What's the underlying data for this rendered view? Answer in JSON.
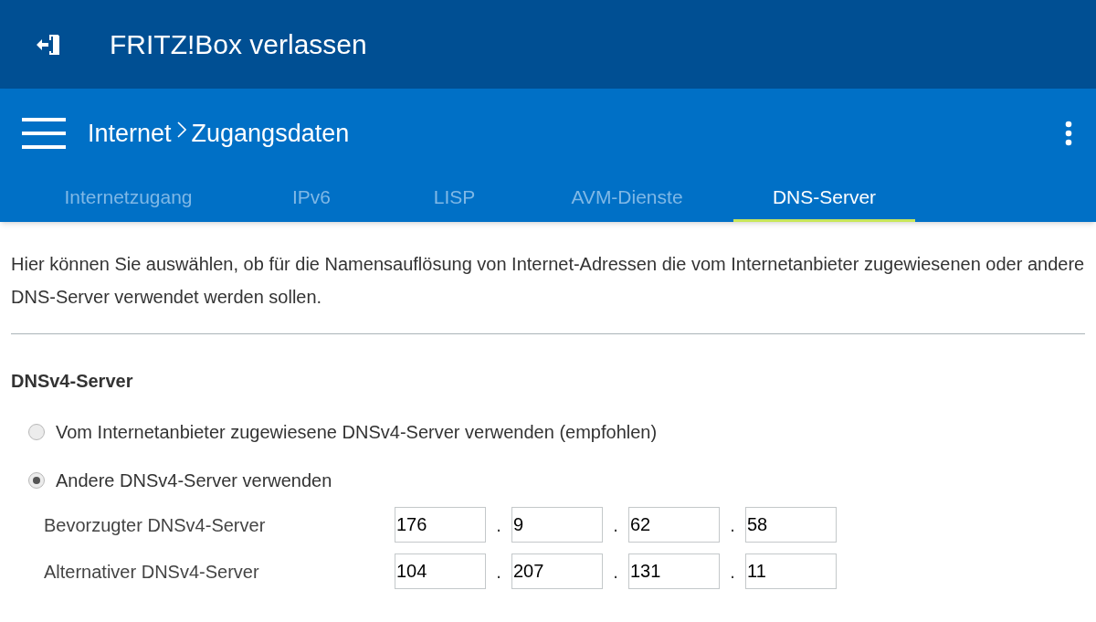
{
  "app_bar": {
    "title": "FRITZ!Box verlassen"
  },
  "breadcrumb": [
    "Internet",
    "Zugangsdaten"
  ],
  "tabs": [
    {
      "label": "Internetzugang",
      "selected": false
    },
    {
      "label": "IPv6",
      "selected": false
    },
    {
      "label": "LISP",
      "selected": false
    },
    {
      "label": "AVM-Dienste",
      "selected": false
    },
    {
      "label": "DNS-Server",
      "selected": true
    }
  ],
  "description": "Hier können Sie auswählen, ob für die Namensauflösung von Internet-Adressen die vom Internetanbieter zugewiesenen oder andere DNS-Server verwendet werden sollen.",
  "section": {
    "heading": "DNSv4-Server",
    "options": [
      {
        "label": "Vom Internetanbieter zugewiesene DNSv4-Server verwenden (empfohlen)",
        "selected": false
      },
      {
        "label": "Andere DNSv4-Server verwenden",
        "selected": true
      }
    ],
    "servers": [
      {
        "label": "Bevorzugter DNSv4-Server",
        "parts": [
          {
            "kind": "octet",
            "value": "176"
          },
          {
            "kind": "dot",
            "text": "."
          },
          {
            "kind": "octet",
            "value": "9"
          },
          {
            "kind": "dot",
            "text": "."
          },
          {
            "kind": "octet",
            "value": "62"
          },
          {
            "kind": "dot",
            "text": "."
          },
          {
            "kind": "octet",
            "value": "58"
          }
        ]
      },
      {
        "label": "Alternativer DNSv4-Server",
        "parts": [
          {
            "kind": "octet",
            "value": "104"
          },
          {
            "kind": "dot",
            "text": "."
          },
          {
            "kind": "octet",
            "value": "207"
          },
          {
            "kind": "dot",
            "text": "."
          },
          {
            "kind": "octet",
            "value": "131"
          },
          {
            "kind": "dot",
            "text": "."
          },
          {
            "kind": "octet",
            "value": "11"
          }
        ]
      }
    ]
  }
}
